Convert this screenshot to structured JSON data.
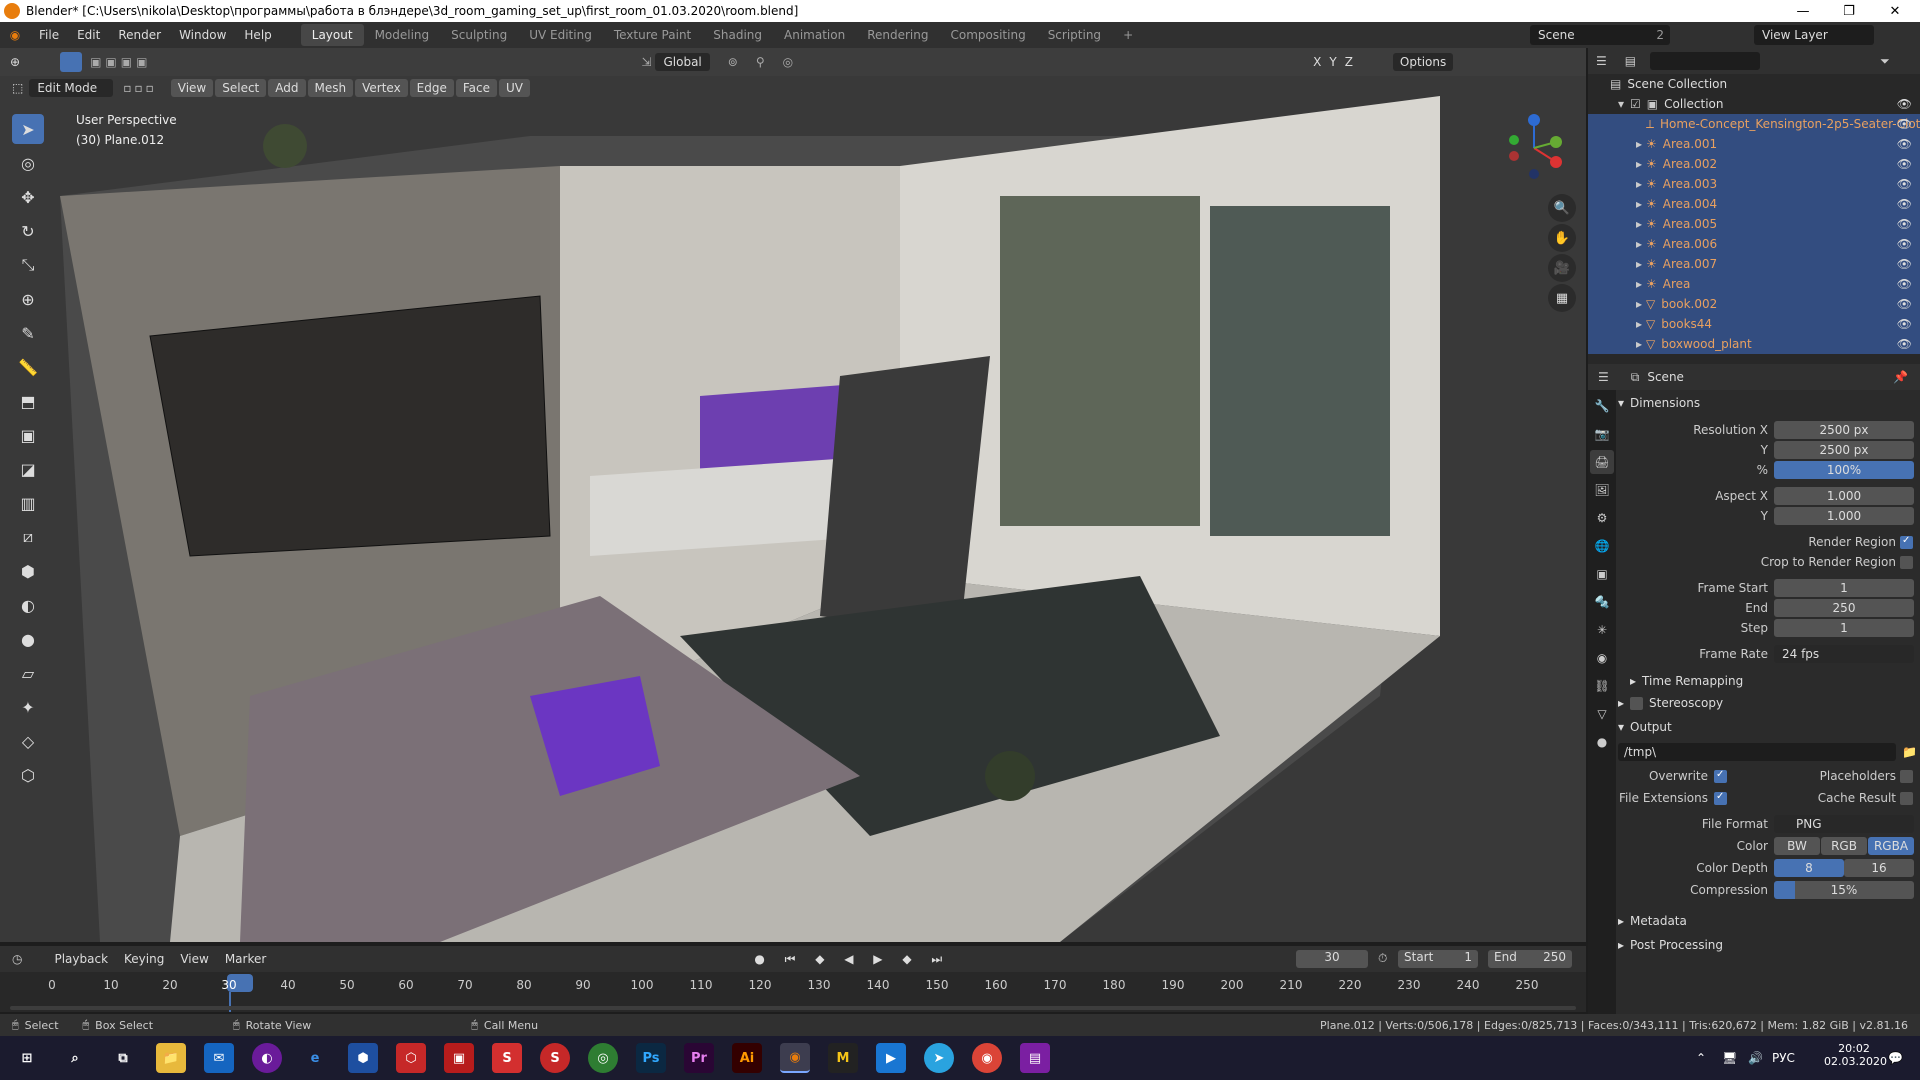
{
  "window": {
    "title": "Blender* [C:\\Users\\nikola\\Desktop\\программы\\работа в блэндере\\3d_room_gaming_set_up\\first_room_01.03.2020\\room.blend]",
    "minimize": "—",
    "maximize": "❐",
    "close": "✕"
  },
  "menu": [
    "File",
    "Edit",
    "Render",
    "Window",
    "Help"
  ],
  "workspaces": [
    "Layout",
    "Modeling",
    "Sculpting",
    "UV Editing",
    "Texture Paint",
    "Shading",
    "Animation",
    "Rendering",
    "Compositing",
    "Scripting",
    "+"
  ],
  "scene": {
    "name": "Scene",
    "count": "2",
    "view_layer": "View Layer"
  },
  "viewport_header": {
    "orientation": "Global",
    "options": "Options",
    "axes": [
      "X",
      "Y",
      "Z"
    ]
  },
  "edit_header": {
    "mode": "Edit Mode",
    "menus": [
      "View",
      "Select",
      "Add",
      "Mesh",
      "Vertex",
      "Edge",
      "Face",
      "UV"
    ]
  },
  "viewport": {
    "perspective": "User Perspective",
    "object": "(30) Plane.012"
  },
  "outliner": {
    "root": "Scene Collection",
    "collection": "Collection",
    "items": [
      "Home-Concept_Kensington-2p5-Seater-Clot",
      "Area.001",
      "Area.002",
      "Area.003",
      "Area.004",
      "Area.005",
      "Area.006",
      "Area.007",
      "Area",
      "book.002",
      "books44",
      "boxwood_plant"
    ]
  },
  "properties": {
    "context": "Scene",
    "dimensions": {
      "title": "Dimensions",
      "res_x_label": "Resolution X",
      "res_x": "2500 px",
      "res_y_label": "Y",
      "res_y": "2500 px",
      "pct_label": "%",
      "pct": "100%",
      "aspect_x_label": "Aspect X",
      "aspect_x": "1.000",
      "aspect_y_label": "Y",
      "aspect_y": "1.000",
      "render_region": "Render Region",
      "crop_region": "Crop to Render Region",
      "frame_start_label": "Frame Start",
      "frame_start": "1",
      "end_label": "End",
      "end": "250",
      "step_label": "Step",
      "step": "1",
      "frame_rate_label": "Frame Rate",
      "frame_rate": "24 fps",
      "time_remapping": "Time Remapping"
    },
    "stereoscopy": "Stereoscopy",
    "output": {
      "title": "Output",
      "path": "/tmp\\",
      "overwrite": "Overwrite",
      "placeholders": "Placeholders",
      "file_extensions": "File Extensions",
      "cache_result": "Cache Result",
      "file_format_label": "File Format",
      "file_format": "PNG",
      "color_label": "Color",
      "color_options": [
        "BW",
        "RGB",
        "RGBA"
      ],
      "depth_label": "Color Depth",
      "depth_options": [
        "8",
        "16"
      ],
      "compression_label": "Compression",
      "compression": "15%"
    },
    "metadata": "Metadata",
    "post_processing": "Post Processing"
  },
  "timeline": {
    "menus": [
      "Playback",
      "Keying",
      "View",
      "Marker"
    ],
    "current": "30",
    "start_label": "Start",
    "start": "1",
    "end_label": "End",
    "end": "250",
    "ticks": [
      "0",
      "10",
      "20",
      "30",
      "40",
      "50",
      "60",
      "70",
      "80",
      "90",
      "100",
      "110",
      "120",
      "130",
      "140",
      "150",
      "160",
      "170",
      "180",
      "190",
      "200",
      "210",
      "220",
      "230",
      "240",
      "250"
    ]
  },
  "statusbar": {
    "select": "Select",
    "box_select": "Box Select",
    "rotate": "Rotate View",
    "call_menu": "Call Menu",
    "stats": "Plane.012 | Verts:0/506,178 | Edges:0/825,713 | Faces:0/343,111 | Tris:620,672 | Mem: 1.82 GiB | v2.81.16"
  },
  "taskbar": {
    "lang": "РУС",
    "time": "20:02",
    "date": "02.03.2020",
    "apps": [
      "Ps",
      "Pr",
      "Ai",
      "M"
    ]
  },
  "colors": {
    "accent": "#4772b3",
    "selected": "#334d80",
    "object_orange": "#e8a060"
  }
}
